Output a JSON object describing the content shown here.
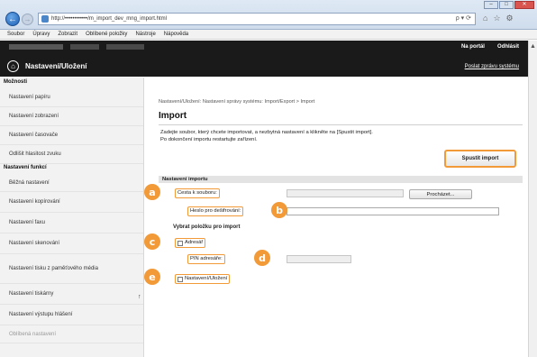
{
  "browser": {
    "address": "http://••••••••••••/m_import_dev_mng_import.html",
    "address_tools": "ρ ▾ ⟳",
    "menu": [
      "Soubor",
      "Úprav​y",
      "Zobrazit",
      "Oblíbené položky",
      "Nástroje",
      "Nápověda"
    ],
    "win_buttons": [
      "–",
      "□",
      "✕"
    ],
    "toolbar_icons": [
      "⌂",
      "☆",
      "⚙"
    ]
  },
  "header": {
    "portal_link": "Na portál",
    "logout_link": "Odhlásit",
    "title": "Nastavení/Uložení",
    "admin_link": "Poslat zprávu systému",
    "home_icon": "home-icon"
  },
  "sidebar": {
    "section1": "Možnosti",
    "items1": [
      "Nastavení papíru",
      "Nastavení zobrazení",
      "Nastavení časovače",
      "Odlišit hlasitost zvuku"
    ],
    "section2": "Nastavení funkcí",
    "items2": [
      "Běžná nastavení",
      "Nastavení kopírování",
      "Nastavení faxu",
      "Nastavení skenování",
      "Nastavení tisku z paměťového média",
      "Nastavení tiskárny",
      "Nastavení výstupu hlášení",
      "Oblíbená nastavení"
    ]
  },
  "main": {
    "breadcrumb": "Nastavení/Uložení: Nastavení správy systému: Import/Export > Import",
    "title": "Import",
    "desc_line1": "Zadejte soubor, který chcete importovat, a nezbytná nastavení a klikněte na [Spustit import].",
    "desc_line2": "Po dokončení importu restartujte zařízení.",
    "start_button": "Spustit import",
    "import_settings_header": "Nastavení importu",
    "file_path_label": "Cesta k souboru:",
    "browse_button": "Procházet...",
    "decrypt_password_label": "Heslo pro dešifrování:",
    "select_items_header": "Vybrat položku pro import",
    "address_book_label": "Adresář",
    "pin_label": "PIN adresáře:",
    "settings_label": "Nastavení/Uložení",
    "end_marker": "↑"
  },
  "callouts": [
    "a",
    "b",
    "c",
    "d",
    "e"
  ],
  "colors": {
    "accent": "#f29a38",
    "header_bg": "#1a1a1a"
  }
}
